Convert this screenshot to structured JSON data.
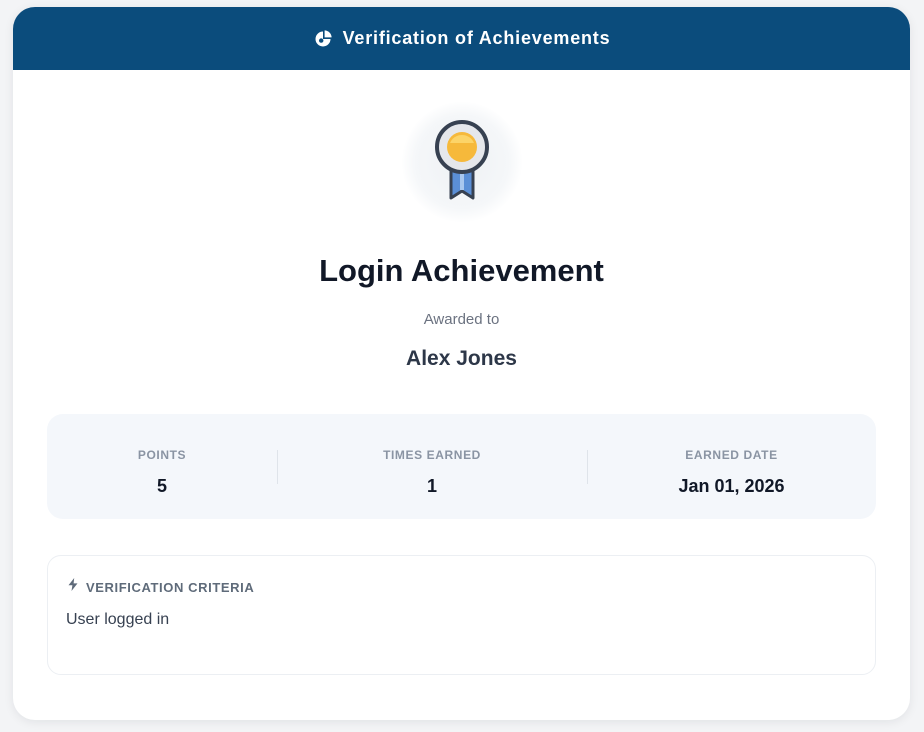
{
  "header": {
    "icon": "pie-chart-icon",
    "title": "Verification of Achievements",
    "background_color": "#0b4c7c"
  },
  "badge": {
    "icon": "award-ribbon-icon",
    "medal_color": "#f6b93b",
    "ribbon_color": "#5b8fd6"
  },
  "achievement": {
    "title": "Login Achievement",
    "awarded_label": "Awarded to",
    "recipient": "Alex Jones"
  },
  "stats": [
    {
      "label": "POINTS",
      "value": "5"
    },
    {
      "label": "TIMES EARNED",
      "value": "1"
    },
    {
      "label": "EARNED DATE",
      "value": "Jan 01, 2026"
    }
  ],
  "criteria": {
    "icon": "lightning-bolt-icon",
    "title": "VERIFICATION CRITERIA",
    "text": "User logged in"
  }
}
